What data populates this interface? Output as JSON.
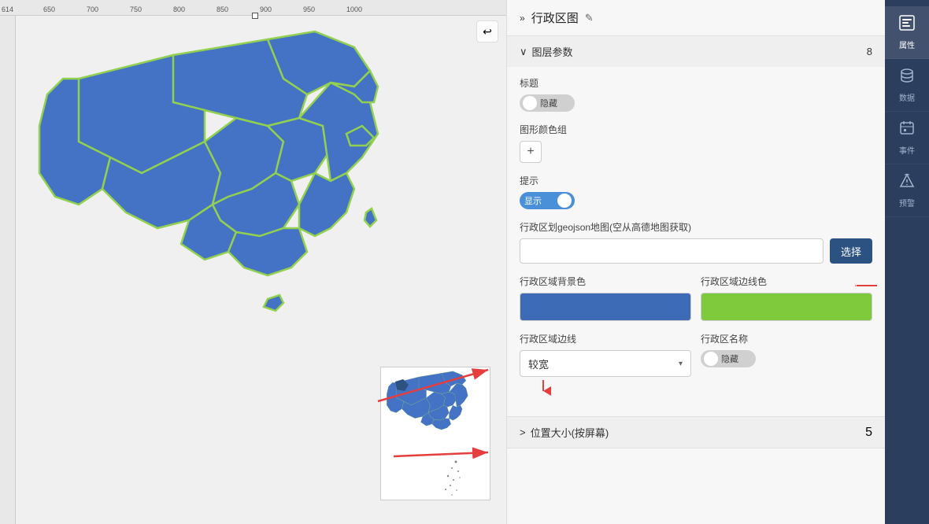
{
  "ruler": {
    "ticks": [
      "614",
      "650",
      "700",
      "750",
      "800",
      "850",
      "900",
      "950",
      "1000"
    ]
  },
  "header": {
    "panel_title": "行政区图",
    "edit_icon": "✎",
    "chevron": "»"
  },
  "section_layer": {
    "label": "图层参数",
    "count": "8",
    "chevron_open": "∨"
  },
  "section_position": {
    "label": "位置大小(按屏幕)",
    "count": "5",
    "chevron_collapsed": ">"
  },
  "fields": {
    "title_label": "标题",
    "title_toggle_text": "隐藏",
    "color_group_label": "图形颜色组",
    "plus_label": "+",
    "hint_label": "提示",
    "hint_toggle_text": "显示",
    "geojson_label": "行政区划geojson地图(空从高德地图获取)",
    "geojson_placeholder": "",
    "select_btn": "选择",
    "bg_color_label": "行政区域背景色",
    "border_color_label": "行政区域边线色",
    "border_width_label": "行政区域边线",
    "border_width_value": "较宽",
    "name_label": "行政区名称",
    "name_toggle_text": "隐藏"
  },
  "colors": {
    "bg_color": "#4472c4",
    "border_color": "#92d050",
    "bg_swatch": "#3d6bb5",
    "border_swatch": "#7eca3c"
  },
  "sidebar": {
    "items": [
      {
        "id": "properties",
        "icon": "🗂",
        "label": "属性",
        "active": true
      },
      {
        "id": "data",
        "icon": "💾",
        "label": "数据",
        "active": false
      },
      {
        "id": "event",
        "icon": "📋",
        "label": "事件",
        "active": false
      },
      {
        "id": "alert",
        "icon": "🔔",
        "label": "预警",
        "active": false
      }
    ]
  }
}
